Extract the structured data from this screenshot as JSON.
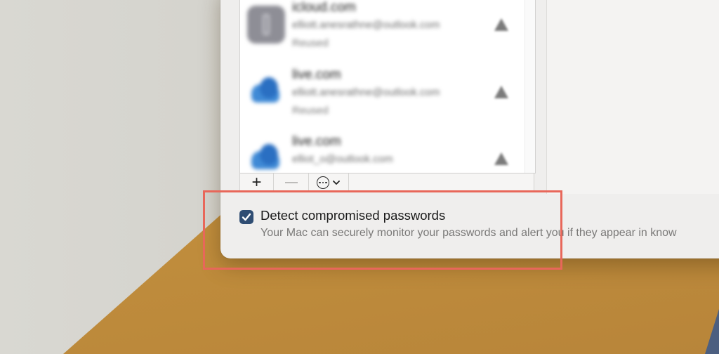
{
  "passwords": {
    "entries": [
      {
        "domain": "icloud.com",
        "username": "elliott.anesrathne@outlook.com",
        "status": "Reused",
        "icon": "icloud-icon"
      },
      {
        "domain": "live.com",
        "username": "elliott.anesrathne@outlook.com",
        "status": "Reused",
        "icon": "microsoft-icon"
      },
      {
        "domain": "live.com",
        "username": "elliot_o@outlook.com",
        "status": "",
        "icon": "microsoft-icon"
      }
    ],
    "toolbar": {
      "add_label": "+",
      "remove_label": "—",
      "more_label": "more options"
    }
  },
  "settings": {
    "detect_compromised": {
      "checked": true,
      "label": "Detect compromised passwords",
      "description": "Your Mac can securely monitor your passwords and alert you if they appear in know"
    }
  },
  "colors": {
    "checkbox": "#2f4d73",
    "highlight": "#e8675a",
    "wallpaper_gold": "#c08d3c"
  }
}
